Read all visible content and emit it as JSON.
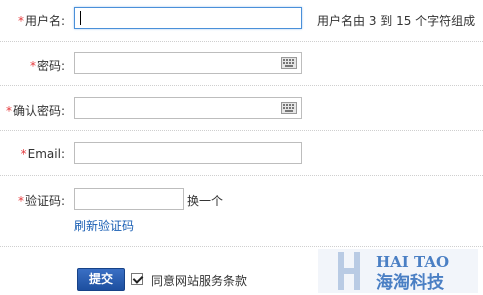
{
  "form": {
    "username": {
      "label": "用户名:",
      "required_mark": "*",
      "value": "",
      "hint": "用户名由 3 到 15 个字符组成"
    },
    "password": {
      "label": "密码:",
      "required_mark": "*",
      "value": "",
      "icon": "keyboard-icon"
    },
    "confirm_password": {
      "label": "确认密码:",
      "required_mark": "*",
      "value": "",
      "icon": "keyboard-icon"
    },
    "email": {
      "label": "Email:",
      "required_mark": "*",
      "value": ""
    },
    "captcha": {
      "label": "验证码:",
      "required_mark": "*",
      "value": "",
      "change_link": "换一个",
      "refresh_link": "刷新验证码"
    },
    "submit_label": "提交",
    "agree": {
      "checked": true,
      "label": "同意网站服务条款"
    }
  },
  "watermark": {
    "line1": "HAI TAO",
    "line2": "海淘科技",
    "letter": "H"
  },
  "colors": {
    "required": "#e4393c",
    "link": "#1a5fb4",
    "button": "#2a5db0",
    "watermark": "#4a7fc4"
  }
}
